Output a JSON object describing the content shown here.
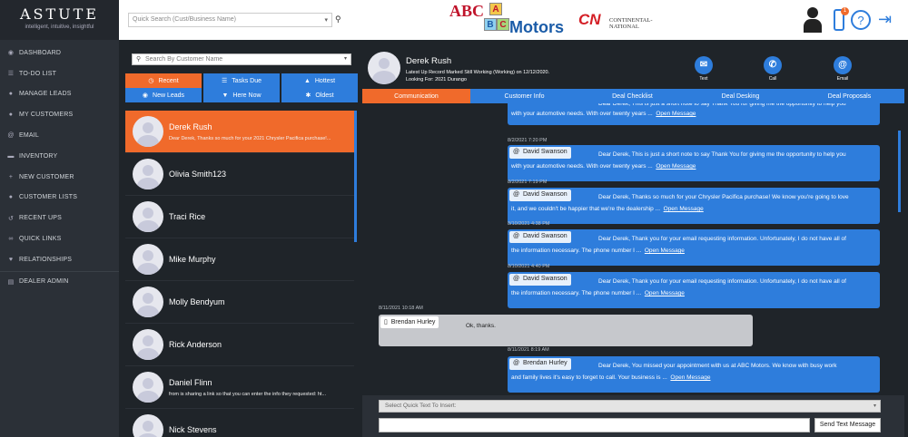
{
  "brand": {
    "name": "ASTUTE",
    "tagline": "intelligent, intuitive, insightful"
  },
  "nav": {
    "items": [
      {
        "label": "DASHBOARD",
        "icon": "dashboard-icon"
      },
      {
        "label": "TO-DO LIST",
        "icon": "list-icon"
      },
      {
        "label": "MANAGE LEADS",
        "icon": "users-icon"
      },
      {
        "label": "MY CUSTOMERS",
        "icon": "user-icon"
      },
      {
        "label": "EMAIL",
        "icon": "at-icon"
      },
      {
        "label": "INVENTORY",
        "icon": "car-icon"
      },
      {
        "label": "NEW CUSTOMER",
        "icon": "plus-icon"
      },
      {
        "label": "CUSTOMER LISTS",
        "icon": "group-icon"
      },
      {
        "label": "RECENT UPS",
        "icon": "history-icon"
      },
      {
        "label": "QUICK LINKS",
        "icon": "link-icon"
      },
      {
        "label": "RELATIONSHIPS",
        "icon": "heart-icon"
      },
      {
        "label": "DEALER ADMIN",
        "icon": "admin-icon"
      }
    ]
  },
  "header": {
    "quick_search_placeholder": "Quick Search (Cust/Business Name)",
    "dealer_logo_text": {
      "abc": "ABC",
      "blocks": [
        "A",
        "B",
        "C"
      ],
      "motors": "Motors"
    },
    "partner_logo": {
      "mark": "CN",
      "text": "CONTINENTAL-NATIONAL"
    },
    "notification_count": "1"
  },
  "contacts": {
    "search_placeholder": "Search By Customer Name",
    "filters": [
      {
        "label": "Recent",
        "icon": "clock-icon",
        "active": true
      },
      {
        "label": "Tasks Due",
        "icon": "list-icon",
        "active": false
      },
      {
        "label": "Hottest",
        "icon": "fire-icon",
        "active": false
      },
      {
        "label": "New Leads",
        "icon": "eye-icon",
        "active": false
      },
      {
        "label": "Here Now",
        "icon": "location-icon",
        "active": false
      },
      {
        "label": "Oldest",
        "icon": "gear-icon",
        "active": false
      }
    ],
    "list": [
      {
        "name": "Derek Rush",
        "preview": "Dear Derek, Thanks so much for your 2021 Chrysler Pacifica purchase!...",
        "active": true
      },
      {
        "name": "Olivia Smith123",
        "preview": ""
      },
      {
        "name": "Traci Rice",
        "preview": ""
      },
      {
        "name": "Mike Murphy",
        "preview": ""
      },
      {
        "name": "Molly Bendyum",
        "preview": ""
      },
      {
        "name": "Rick Anderson",
        "preview": ""
      },
      {
        "name": "Daniel Flinn",
        "preview": "from is sharing a link so that you can enter the info they requested: ht..."
      },
      {
        "name": "Nick Stevens",
        "preview": ""
      }
    ]
  },
  "conversation": {
    "customer_name": "Derek Rush",
    "status_line": "Latest Up Record Marked Still Working (Working) on 12/12/2020.",
    "looking_for": "Looking For: 2021 Durango",
    "actions": [
      {
        "label": "Text",
        "icon": "chat-icon",
        "glyph": "✉"
      },
      {
        "label": "Call",
        "icon": "phone-icon",
        "glyph": "✆"
      },
      {
        "label": "Email",
        "icon": "at-icon",
        "glyph": "@"
      }
    ],
    "tabs": [
      {
        "label": "Communication",
        "active": true
      },
      {
        "label": "Customer Info"
      },
      {
        "label": "Deal Checklist"
      },
      {
        "label": "Deal Desking"
      },
      {
        "label": "Deal Proposals"
      }
    ],
    "messages": [
      {
        "timestamp": "",
        "sender": "",
        "line1": "Dear Derek, This is just a short note to say Thank You for giving me the opportunity to help you",
        "line2": "with your automotive needs. With over twenty years ...",
        "open": "Open Message",
        "dir": "out"
      },
      {
        "timestamp": "8/2/2021 7:20 PM",
        "sender": "David Swanson",
        "line1": "Dear Derek, This is just a short note to say Thank You for giving me the opportunity to help you",
        "line2": "with your automotive needs. With over twenty years ...",
        "open": "Open Message",
        "dir": "out"
      },
      {
        "timestamp": "8/2/2021 7:19 PM",
        "sender": "David Swanson",
        "line1": "Dear Derek, Thanks so much for your Chrysler Pacifica purchase! We know you're going to love",
        "line2": "it, and we couldn't be happier that we're the dealership ...",
        "open": "Open Message",
        "dir": "out"
      },
      {
        "timestamp": "8/10/2021 4:38 PM",
        "sender": "David Swanson",
        "line1": "Dear Derek, Thank you for your email requesting information. Unfortunately, I do not have all of",
        "line2": "the information necessary. The phone number I ...",
        "open": "Open Message",
        "dir": "out"
      },
      {
        "timestamp": "8/10/2021 4:40 PM",
        "sender": "David Swanson",
        "line1": "Dear Derek, Thank you for your email requesting information. Unfortunately, I do not have all of",
        "line2": "the information necessary. The phone number I ...",
        "open": "Open Message",
        "dir": "out"
      },
      {
        "timestamp": "8/11/2021 10:18 AM",
        "sender": "Brendan Hurley",
        "line1": "Ok, thanks.",
        "line2": "",
        "open": "",
        "dir": "in"
      },
      {
        "timestamp": "8/11/2021 8:19 AM",
        "sender": "Brendan Hurley",
        "line1": "Dear Derek, You missed your appointment with us at ABC Motors. We know with busy work",
        "line2": "and family lives it's easy to forget to call. Your business is ...",
        "open": "Open Message",
        "dir": "out"
      }
    ],
    "quick_text_placeholder": "Select Quick Text To Insert:",
    "send_label": "Send Text Message"
  },
  "colors": {
    "accent_blue": "#2e7ddc",
    "accent_orange": "#f06a2b",
    "dark_bg": "#1f2429",
    "nav_bg": "#2b3037"
  }
}
